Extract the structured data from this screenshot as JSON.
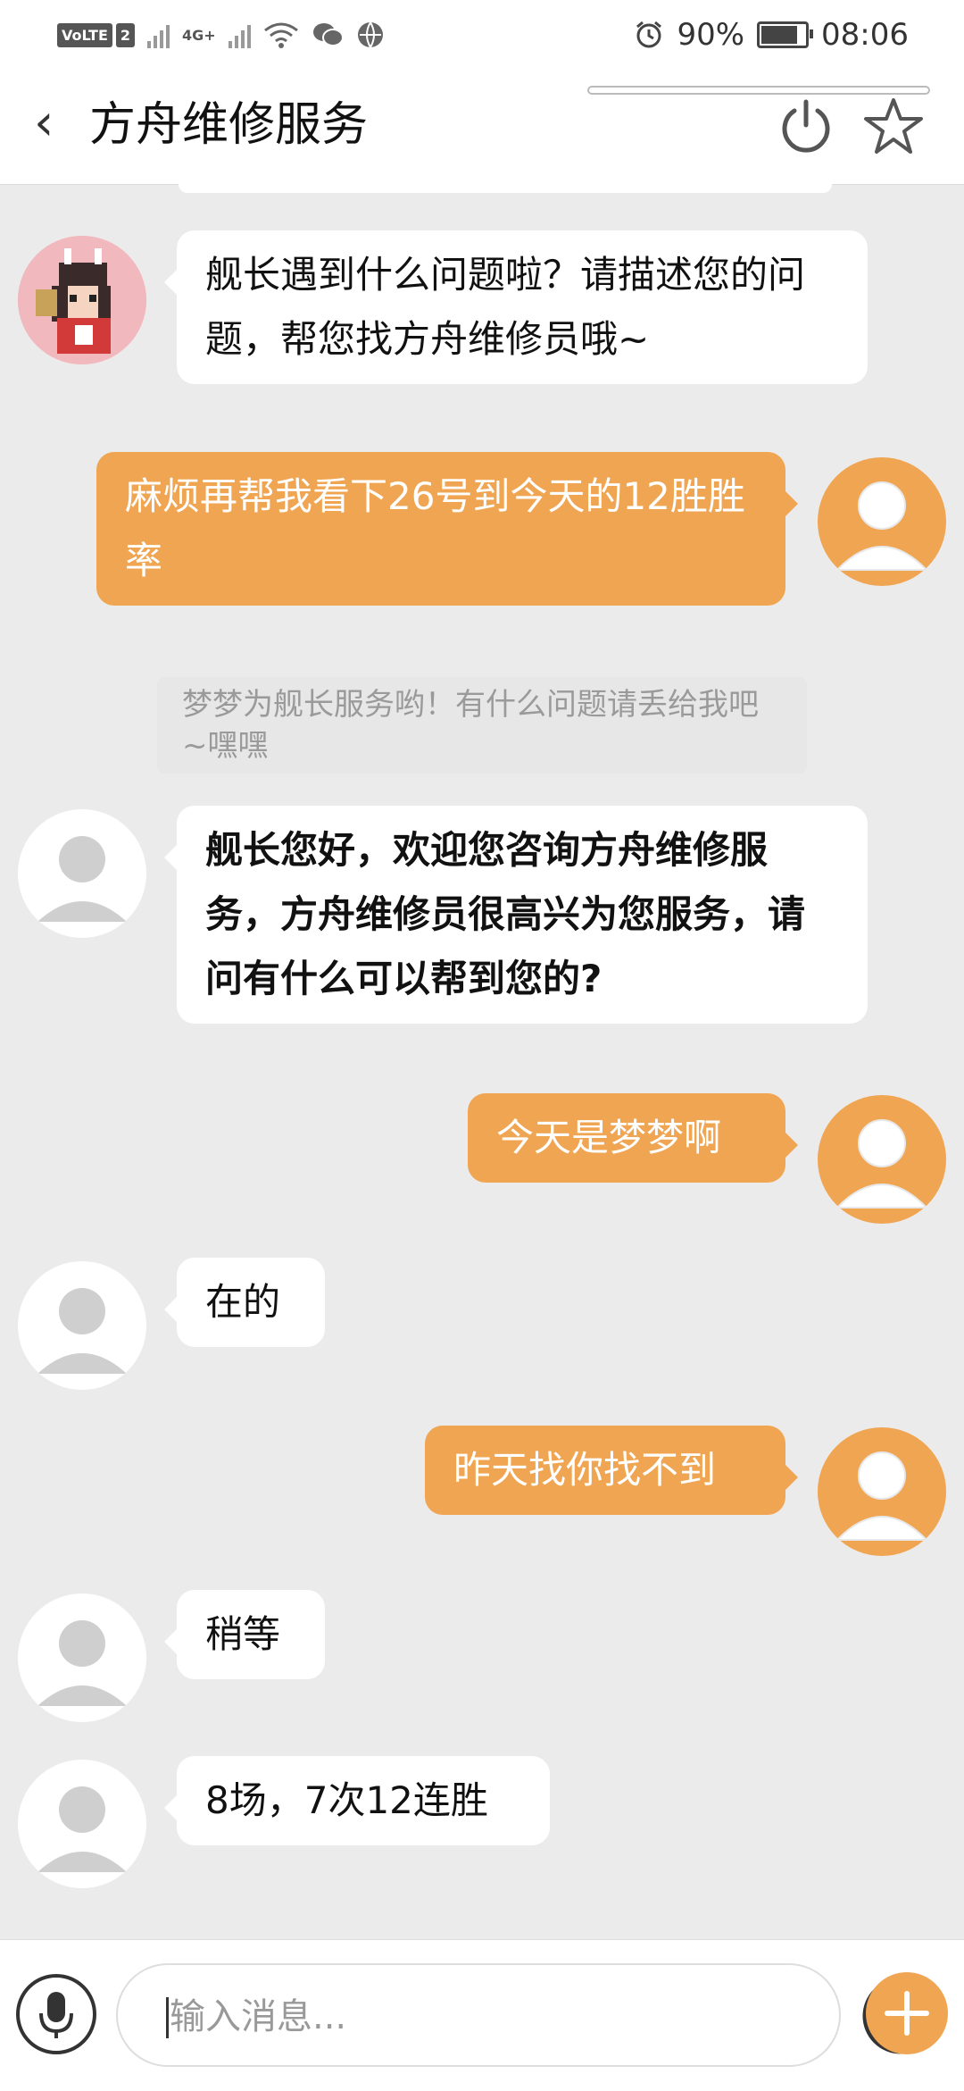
{
  "status_bar": {
    "network_label": "VoLTE",
    "sim_number": "2",
    "network_type": "4G+",
    "battery_percent_text": "90%",
    "battery_level": 0.9,
    "time": "08:06",
    "icons": [
      "volte-icon",
      "signal-icon",
      "signal-icon",
      "wifi-icon",
      "wechat-icon",
      "globe-icon",
      "alarm-icon",
      "battery-icon"
    ]
  },
  "header": {
    "back_label": "‹",
    "title": "方舟维修服务"
  },
  "messages": [
    {
      "side": "in",
      "avatar": "pixel-character-avatar",
      "text": "舰长遇到什么问题啦？请描述您的问题，帮您找方舟维修员哦~"
    },
    {
      "side": "out",
      "avatar": "user-avatar",
      "text": "麻烦再帮我看下26号到今天的12胜胜率"
    },
    {
      "side": "system",
      "text": "梦梦为舰长服务哟！有什么问题请丢给我吧~嘿嘿"
    },
    {
      "side": "in",
      "avatar": "agent-avatar",
      "bold": true,
      "text": "舰长您好，欢迎您咨询方舟维修服务，方舟维修员很高兴为您服务，请问有什么可以帮到您的?"
    },
    {
      "side": "out",
      "avatar": "user-avatar",
      "text": "今天是梦梦啊"
    },
    {
      "side": "in",
      "avatar": "agent-avatar",
      "text": "在的"
    },
    {
      "side": "out",
      "avatar": "user-avatar",
      "text": "昨天找你找不到"
    },
    {
      "side": "in",
      "avatar": "agent-avatar",
      "text": "稍等"
    },
    {
      "side": "in",
      "avatar": "agent-avatar",
      "text": "8场，7次12连胜"
    }
  ],
  "input": {
    "placeholder": "输入消息..."
  },
  "colors": {
    "accent": "#f0a552",
    "background": "#ebebeb",
    "bubble_in": "#ffffff"
  }
}
